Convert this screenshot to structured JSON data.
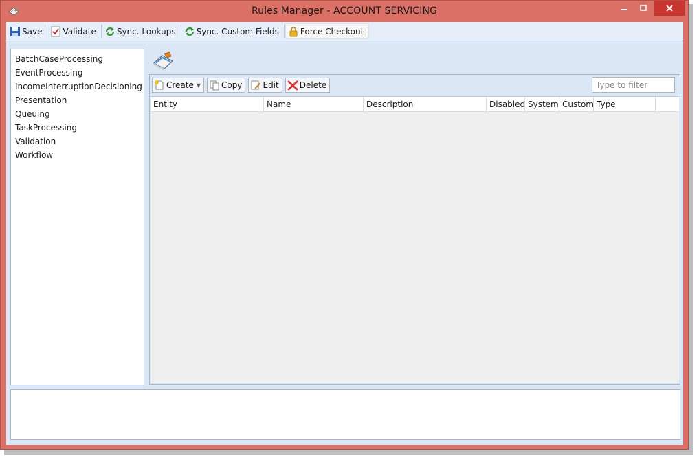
{
  "window": {
    "title": "Rules Manager - ACCOUNT SERVICING",
    "frame_color": "#db7066",
    "close_color": "#c7372f"
  },
  "toolbar": {
    "save_label": "Save",
    "validate_label": "Validate",
    "sync_lookups_label": "Sync. Lookups",
    "sync_custom_fields_label": "Sync. Custom Fields",
    "force_checkout_label": "Force Checkout"
  },
  "categories": [
    "BatchCaseProcessing",
    "EventProcessing",
    "IncomeInterruptionDecisioning",
    "Presentation",
    "Queuing",
    "TaskProcessing",
    "Validation",
    "Workflow"
  ],
  "grid_toolbar": {
    "create_label": "Create",
    "copy_label": "Copy",
    "edit_label": "Edit",
    "delete_label": "Delete",
    "filter_placeholder": "Type to filter"
  },
  "table": {
    "columns": [
      "Entity",
      "Name",
      "Description",
      "Disabled",
      "System",
      "Custom",
      "Type"
    ],
    "rows": []
  }
}
